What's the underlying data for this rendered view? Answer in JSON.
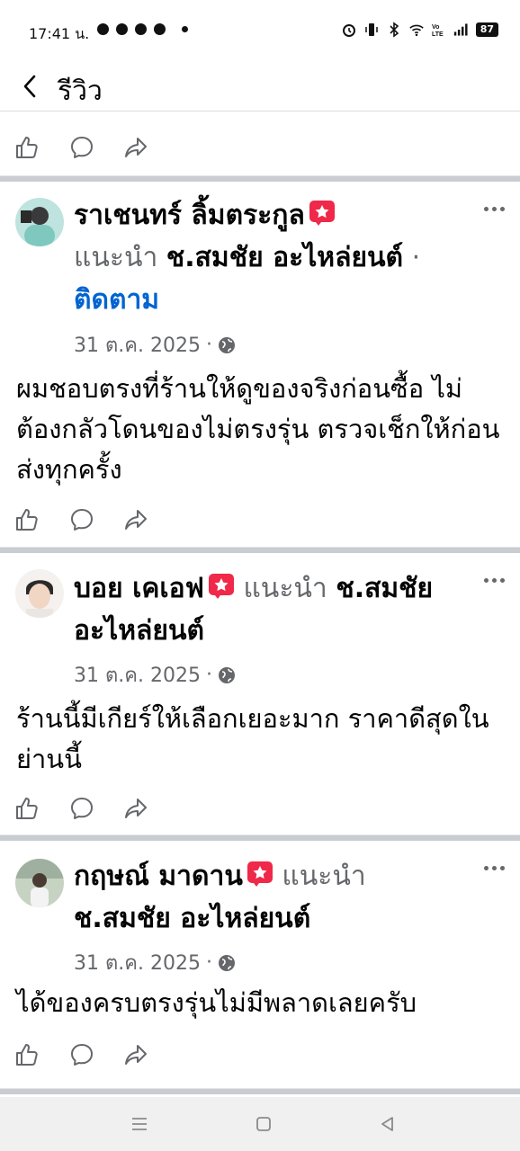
{
  "status_bar": {
    "time": "17:41 น.",
    "battery": "87"
  },
  "header": {
    "title": "รีวิว"
  },
  "reviews": [
    {
      "name": "ราเชนทร์  ลิ้มตระกูล",
      "recommend": "แนะนำ",
      "page": "ช.สมชัย อะไหล่ยนต์",
      "follow": "ติดตาม",
      "date": "31 ต.ค. 2025",
      "text": "ผมชอบตรงที่ร้านให้ดูของจริงก่อนซื้อ ไม่ต้องกลัวโดนของไม่ตรงรุ่น ตรวจเช็กให้ก่อนส่งทุกครั้ง"
    },
    {
      "name": "บอย เคเอฟ",
      "recommend": "แนะนำ",
      "page": "ช.สมชัย อะไหล่ยนต์",
      "date": "31 ต.ค. 2025",
      "text": "ร้านนี้มีเกียร์ให้เลือกเยอะมาก ราคาดีสุดในย่านนี้"
    },
    {
      "name": "กฤษณ์ มาดาน",
      "recommend": "แนะนำ",
      "page": "ช.สมชัย อะไหล่ยนต์",
      "date": "31 ต.ค. 2025",
      "text": "ได้ของครบตรงรุ่นไม่มีพลาดเลยครับ"
    }
  ],
  "colors": {
    "link": "#0064d1",
    "secondary": "#65676b",
    "badge": "#f02849"
  },
  "icons": [
    "back-icon",
    "like-icon",
    "comment-icon",
    "share-icon",
    "more-icon",
    "globe-icon",
    "star-badge-icon"
  ]
}
